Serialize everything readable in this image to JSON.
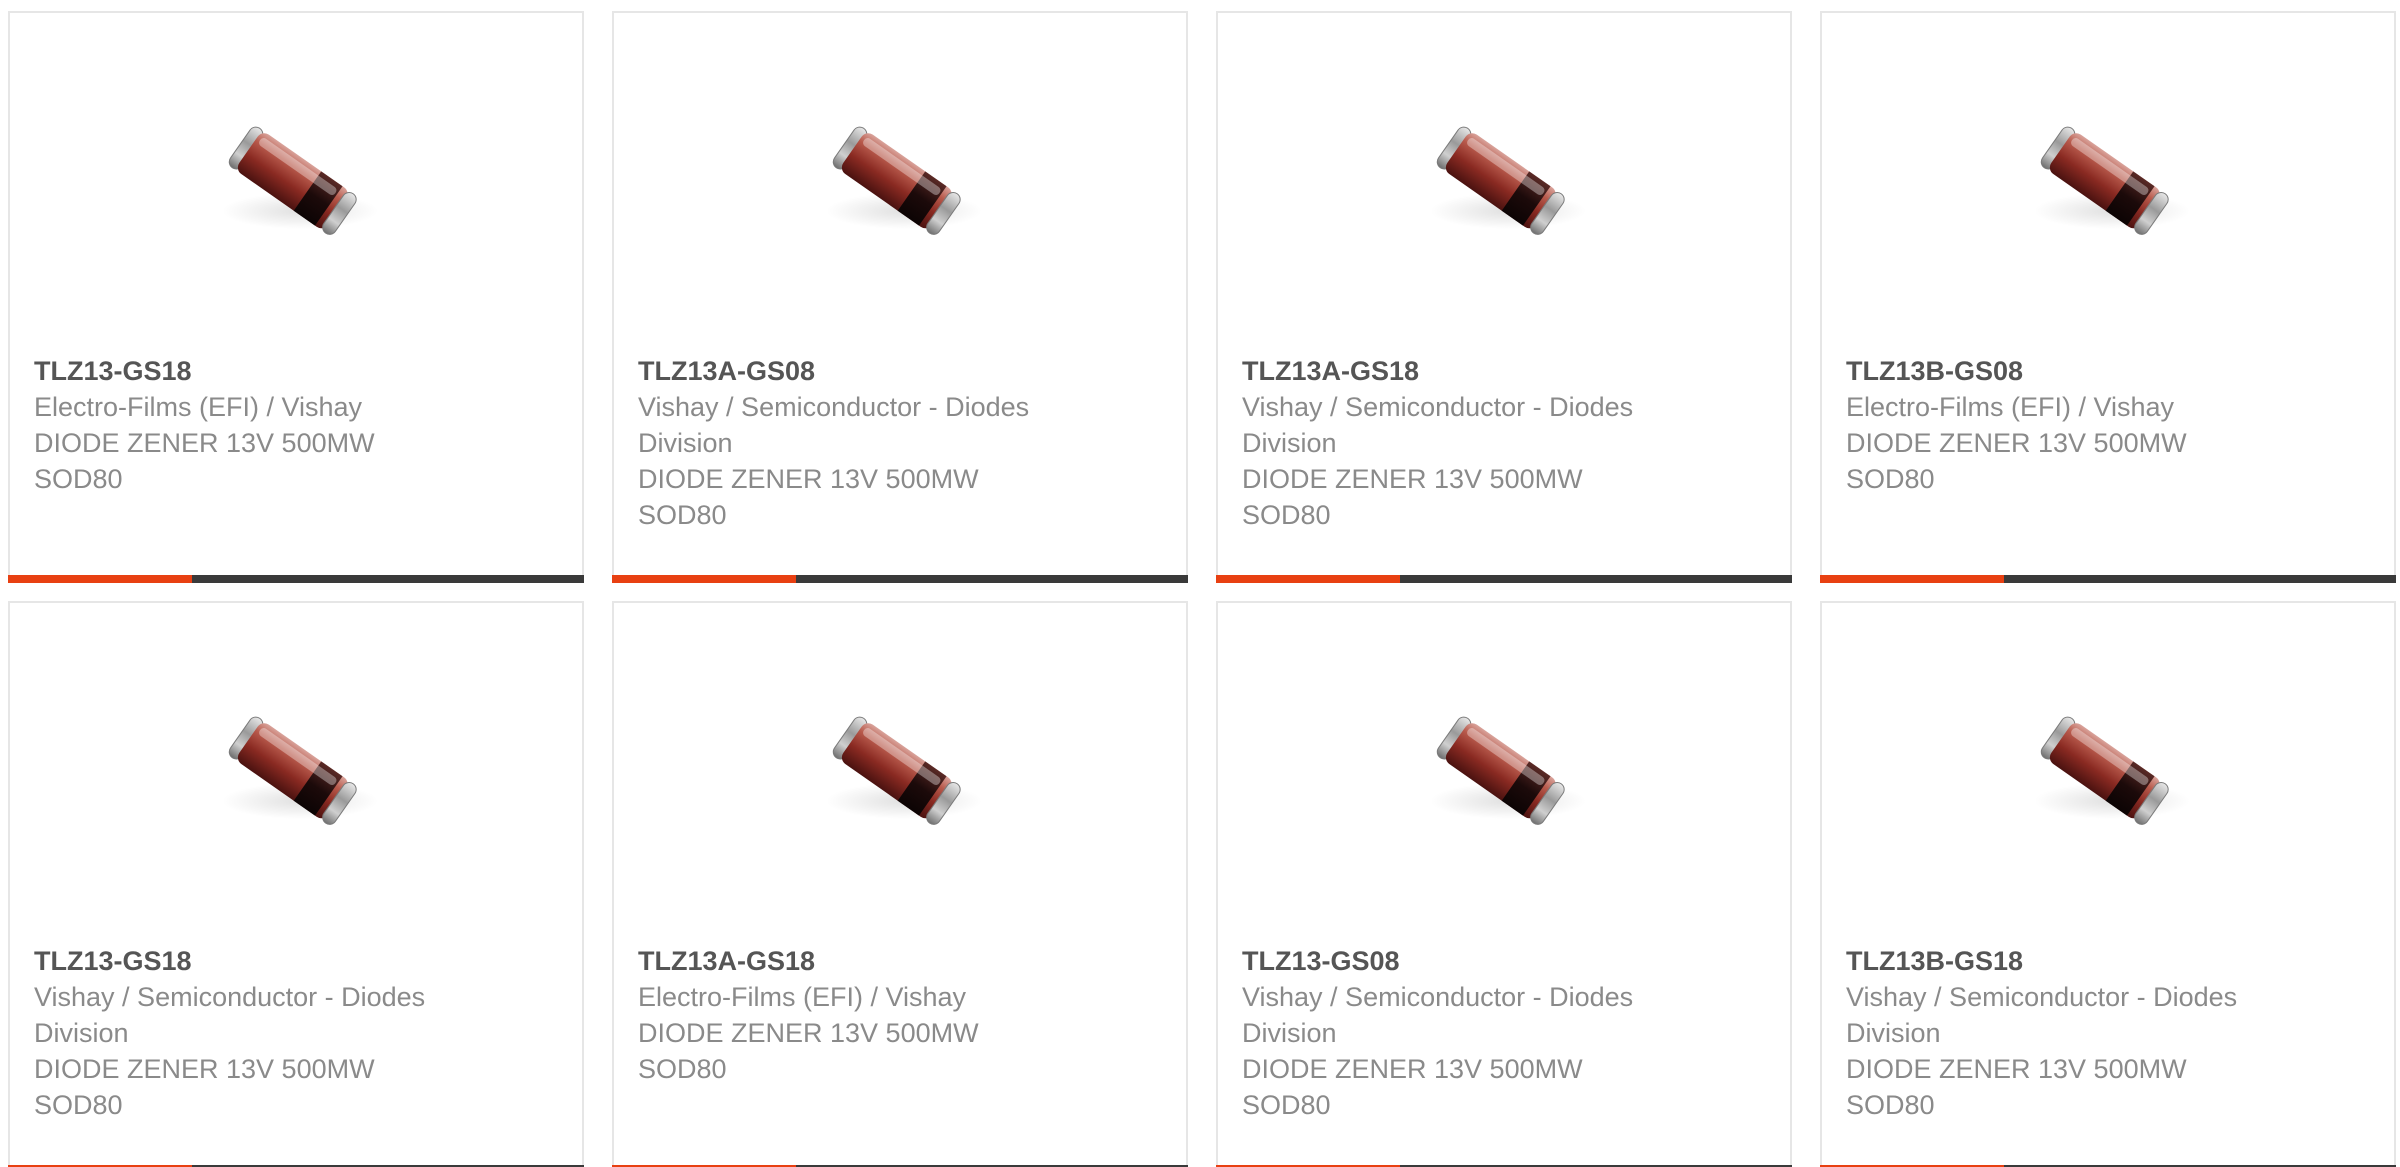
{
  "accent_color": "#e84012",
  "bar_color": "#3a3a3a",
  "products": [
    {
      "part_number": "TLZ13-GS18",
      "manufacturer": "Electro-Films (EFI) / Vishay",
      "description": "DIODE ZENER 13V 500MW",
      "package": "SOD80",
      "image_icon": "zener-diode-image"
    },
    {
      "part_number": "TLZ13A-GS08",
      "manufacturer": "Vishay / Semiconductor - Diodes Division",
      "description": "DIODE ZENER 13V 500MW",
      "package": "SOD80",
      "image_icon": "zener-diode-image"
    },
    {
      "part_number": "TLZ13A-GS18",
      "manufacturer": "Vishay / Semiconductor - Diodes Division",
      "description": "DIODE ZENER 13V 500MW",
      "package": "SOD80",
      "image_icon": "zener-diode-image"
    },
    {
      "part_number": "TLZ13B-GS08",
      "manufacturer": "Electro-Films (EFI) / Vishay",
      "description": "DIODE ZENER 13V 500MW",
      "package": "SOD80",
      "image_icon": "zener-diode-image"
    },
    {
      "part_number": "TLZ13-GS18",
      "manufacturer": "Vishay / Semiconductor - Diodes Division",
      "description": "DIODE ZENER 13V 500MW",
      "package": "SOD80",
      "image_icon": "zener-diode-image"
    },
    {
      "part_number": "TLZ13A-GS18",
      "manufacturer": "Electro-Films (EFI) / Vishay",
      "description": "DIODE ZENER 13V 500MW",
      "package": "SOD80",
      "image_icon": "zener-diode-image"
    },
    {
      "part_number": "TLZ13-GS08",
      "manufacturer": "Vishay / Semiconductor - Diodes Division",
      "description": "DIODE ZENER 13V 500MW",
      "package": "SOD80",
      "image_icon": "zener-diode-image"
    },
    {
      "part_number": "TLZ13B-GS18",
      "manufacturer": "Vishay / Semiconductor - Diodes Division",
      "description": "DIODE ZENER 13V 500MW",
      "package": "SOD80",
      "image_icon": "zener-diode-image"
    }
  ]
}
